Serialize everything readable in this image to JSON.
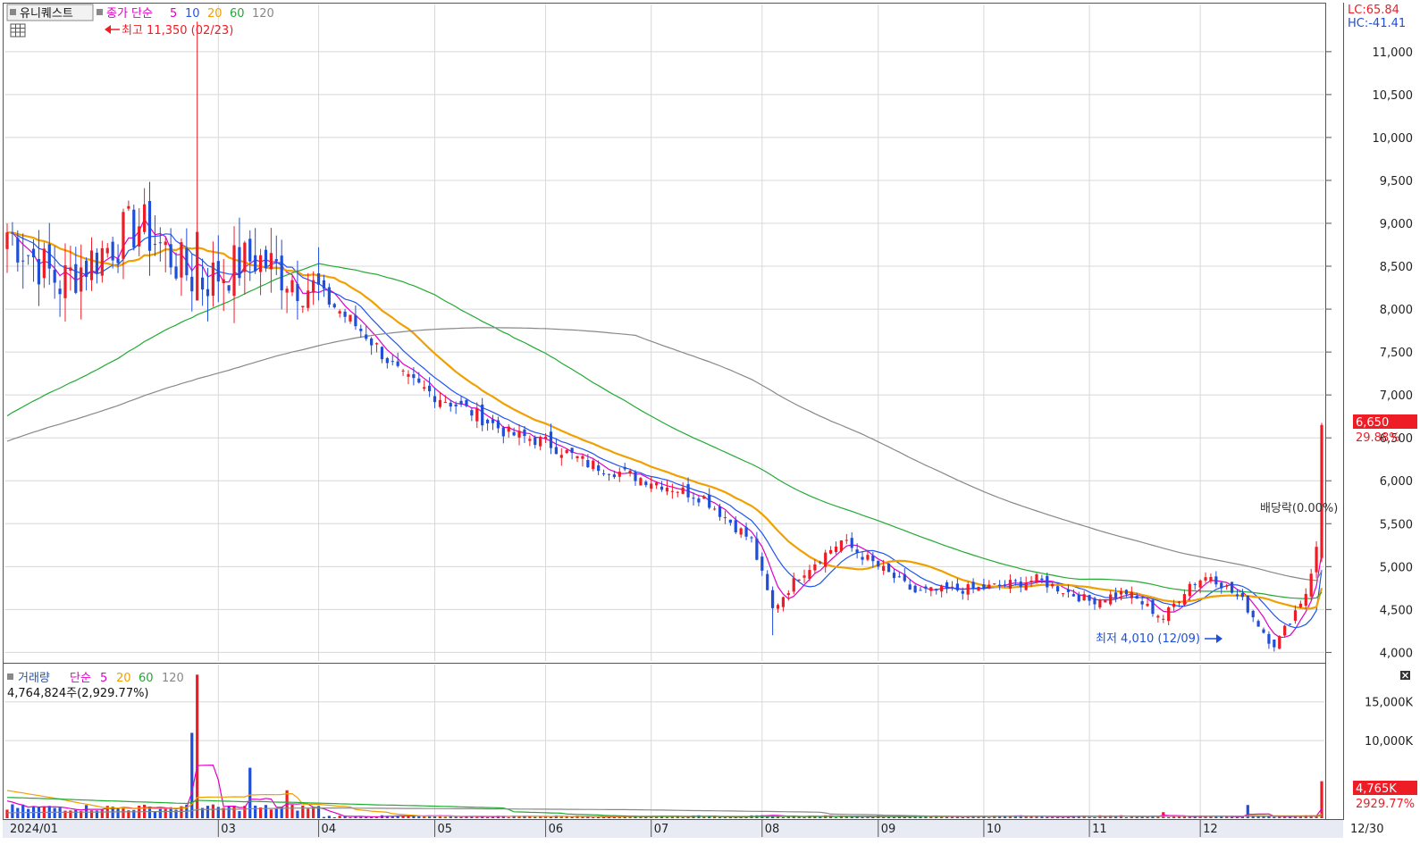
{
  "stock_name": "유니퀘스트",
  "price_legend": {
    "series_label": "종가 단순",
    "periods": [
      {
        "label": "5",
        "color": "#e000c8"
      },
      {
        "label": "10",
        "color": "#2255ee"
      },
      {
        "label": "20",
        "color": "#f0a000"
      },
      {
        "label": "60",
        "color": "#22aa33"
      },
      {
        "label": "120",
        "color": "#888888"
      }
    ]
  },
  "volume_legend": {
    "series_label": "거래량",
    "ma_label": "단순",
    "periods": [
      {
        "label": "5",
        "color": "#e000c8"
      },
      {
        "label": "20",
        "color": "#f0a000"
      },
      {
        "label": "60",
        "color": "#22aa33"
      },
      {
        "label": "120",
        "color": "#888888"
      }
    ],
    "current_text": "4,764,824주(2,929.77%)"
  },
  "right_top": {
    "lc": "LC:65.84",
    "hc": "HC:-41.41"
  },
  "annotations": {
    "high": "최고 11,350 (02/23)",
    "low": "최저 4,010 (12/09)",
    "dividend": "배당락(0.00%)"
  },
  "price_badge": {
    "value": "6,650",
    "pct": "29.88%"
  },
  "volume_badge": {
    "value": "4,765K",
    "pct": "2929.77%"
  },
  "colors": {
    "up": "#ee1c25",
    "down": "#1f4ed8",
    "grid": "#d8d8d8",
    "badge": "#ee1c25"
  },
  "chart_data": [
    {
      "type": "candlestick",
      "title": "유니퀘스트",
      "yticks": [
        "11,000",
        "10,500",
        "10,000",
        "9,500",
        "9,000",
        "8,500",
        "8,000",
        "7,500",
        "7,000",
        "6,500",
        "6,000",
        "5,500",
        "5,000",
        "4,500",
        "4,000"
      ],
      "xticks": [
        "2024/01",
        "03",
        "04",
        "05",
        "06",
        "07",
        "08",
        "09",
        "10",
        "11",
        "12",
        "12/30"
      ],
      "ylim": [
        3900,
        11550
      ],
      "key_points": [
        {
          "date": "01/02",
          "close": 8900
        },
        {
          "date": "02/23",
          "high": 11350
        },
        {
          "date": "03/29",
          "close": 7900
        },
        {
          "date": "04/19",
          "close": 6700
        },
        {
          "date": "05/31",
          "close": 6400
        },
        {
          "date": "07/31",
          "close": 5300
        },
        {
          "date": "08/05",
          "low": 4200
        },
        {
          "date": "09/30",
          "close": 4700
        },
        {
          "date": "11/15",
          "close": 4400
        },
        {
          "date": "12/09",
          "low": 4010
        },
        {
          "date": "12/30",
          "close": 6650
        }
      ],
      "moving_averages": [
        {
          "period": "5",
          "end": 5150
        },
        {
          "period": "10",
          "end": 4960
        },
        {
          "period": "20",
          "end": 4750
        },
        {
          "period": "60",
          "end": 4700
        },
        {
          "period": "120",
          "end": 4950
        }
      ]
    },
    {
      "type": "bar",
      "title": "거래량",
      "yticks": [
        "15,000K",
        "10,000K"
      ],
      "ylim": [
        0,
        19800
      ],
      "unit": "K",
      "last_value": 4765,
      "peak_value": 18500
    }
  ]
}
